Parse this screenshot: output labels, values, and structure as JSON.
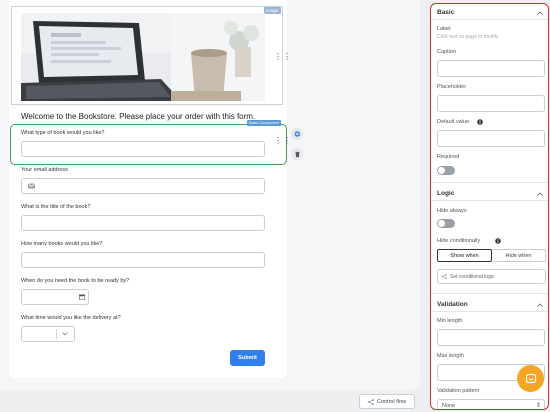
{
  "canvas": {
    "image_tag": "Image",
    "welcome_text": "Welcome to the Bookstore. Please place your order with this form.",
    "selected_tag": "Basic Component",
    "fields": [
      {
        "label": "What type of book would you like?"
      },
      {
        "label": "Your email address"
      },
      {
        "label": "What is the title of the book?"
      },
      {
        "label": "How many books would you like?"
      },
      {
        "label": "When do you need the book to be ready by?"
      },
      {
        "label": "What time would you like the delivery at?"
      }
    ],
    "submit_label": "Submit"
  },
  "control_flow_label": "Control flow",
  "panel": {
    "basic": {
      "title": "Basic",
      "label_title": "Label",
      "label_hint": "Click text on page to modify",
      "caption": "Caption",
      "placeholder": "Placeholder",
      "default_value": "Default value",
      "required": "Required"
    },
    "logic": {
      "title": "Logic",
      "hide_always": "Hide always",
      "hide_conditionally": "Hide conditionally",
      "show_when": "Show when",
      "hide_when": "Hide when",
      "set_conditional_logic": "Set conditional logic"
    },
    "validation": {
      "title": "Validation",
      "min_length": "Min length",
      "max_length": "Max length",
      "validation_pattern": "Validation pattern",
      "pattern_value": "None"
    }
  },
  "colors": {
    "selection": "#3f9f52",
    "panel_highlight": "#e02828",
    "submit": "#2f80ed",
    "chat": "#f5a623",
    "settings_icon": "#2f80ed"
  },
  "icons": [
    "drag-handle-icon",
    "gear-icon",
    "trash-icon",
    "mail-icon",
    "calendar-icon",
    "chevron-down-icon",
    "chevron-up-icon",
    "info-icon",
    "flow-icon",
    "chat-icon"
  ]
}
